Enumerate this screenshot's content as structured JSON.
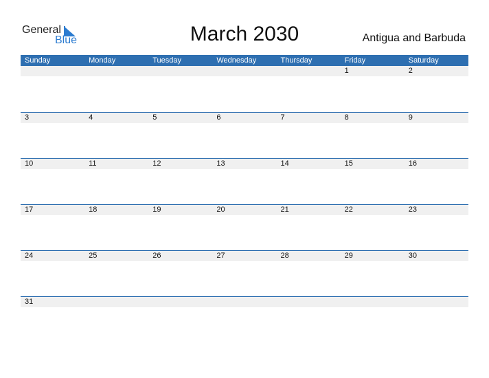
{
  "logo": {
    "general": "General",
    "blue": "Blue"
  },
  "title": "March 2030",
  "country": "Antigua and Barbuda",
  "weekdays": [
    "Sunday",
    "Monday",
    "Tuesday",
    "Wednesday",
    "Thursday",
    "Friday",
    "Saturday"
  ],
  "weeks": [
    [
      "",
      "",
      "",
      "",
      "",
      "1",
      "2"
    ],
    [
      "3",
      "4",
      "5",
      "6",
      "7",
      "8",
      "9"
    ],
    [
      "10",
      "11",
      "12",
      "13",
      "14",
      "15",
      "16"
    ],
    [
      "17",
      "18",
      "19",
      "20",
      "21",
      "22",
      "23"
    ],
    [
      "24",
      "25",
      "26",
      "27",
      "28",
      "29",
      "30"
    ],
    [
      "31",
      "",
      "",
      "",
      "",
      "",
      ""
    ]
  ]
}
